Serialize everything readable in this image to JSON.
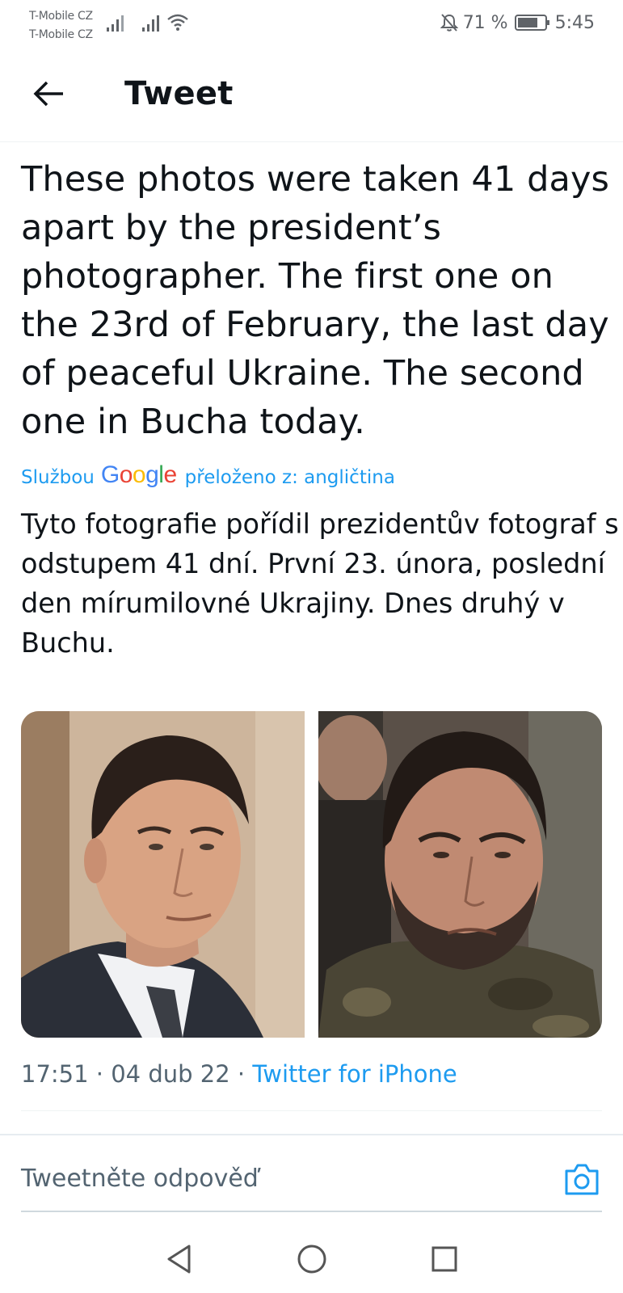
{
  "status_bar": {
    "carrier_1": "T-Mobile CZ",
    "carrier_2": "T-Mobile CZ",
    "battery_percent": "71 %",
    "time": "5:45"
  },
  "header": {
    "title": "Tweet"
  },
  "tweet": {
    "text": "These photos were taken 41 days apart by the president’s photographer. The first one on the 23rd of February, the last day of peaceful Ukraine. The second one in Bucha today.",
    "translation_prefix": "Službou",
    "translation_suffix": "přeloženo z: angličtina",
    "translated_text": "Tyto fotografie pořídil prezidentův fotograf s odstupem 41 dní. První 23. února, poslední den mírumilovné Ukrajiny. Dnes druhý v Buchu.",
    "time": "17:51",
    "date": "04 dub 22",
    "source": "Twitter for iPhone"
  },
  "google_logo": [
    "G",
    "o",
    "o",
    "g",
    "l",
    "e"
  ],
  "reply": {
    "placeholder": "Tweetněte odpověď"
  },
  "colors": {
    "accent": "#1d9bf0",
    "text": "#0f1419",
    "secondary_text": "#536471"
  },
  "icons": {
    "back": "arrow-left-icon",
    "camera": "camera-icon",
    "nav_back": "triangle-back-icon",
    "nav_home": "circle-home-icon",
    "nav_recent": "square-recent-icon"
  }
}
